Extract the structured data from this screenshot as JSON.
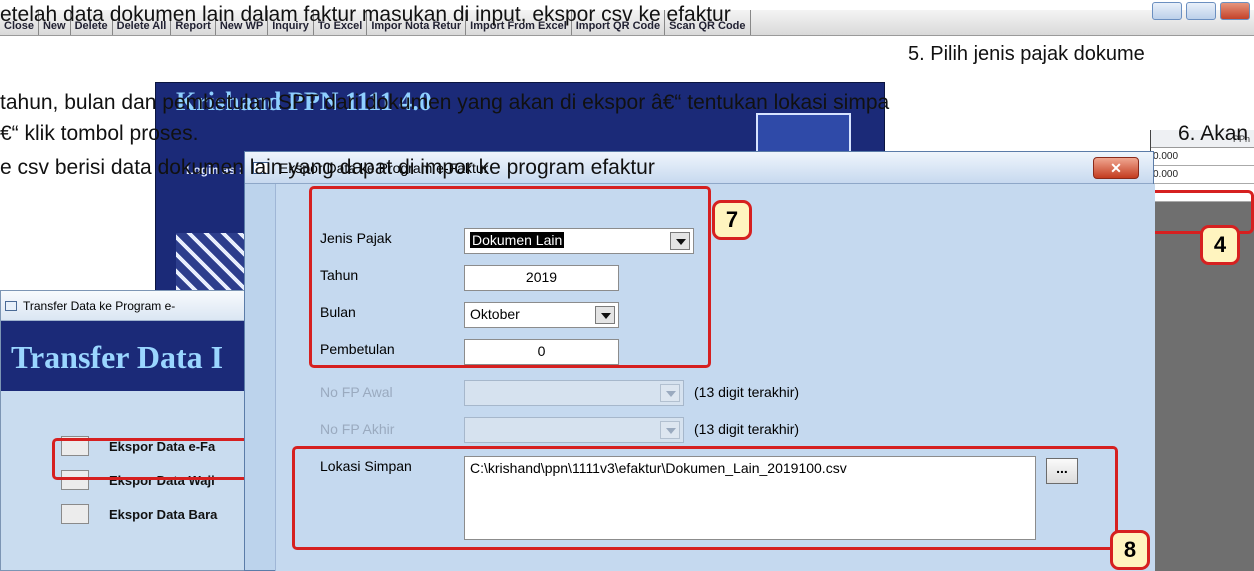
{
  "background_app": {
    "toolbar": [
      "Close",
      "New",
      "Delete",
      "Delete All",
      "Report",
      "New WP",
      "Inquiry",
      "To Excel",
      "Impor Nota Retur",
      "Import From Excel",
      "Import QR Code",
      "Scan QR Code"
    ],
    "logo": "Krishand PPN 1111 4.0",
    "login_label": "Login as :",
    "grid_header": "PPn",
    "grid_values": [
      "0.000",
      "0.000"
    ]
  },
  "transfer_window": {
    "title": "Transfer Data ke Program e-",
    "banner": "Transfer Data I",
    "items": [
      "Ekspor Data e-Fa",
      "Ekspor Data Waji",
      "Ekspor Data Bara"
    ]
  },
  "dialog": {
    "title": "Ekspor Data ke Program e-Faktur",
    "close_symbol": "✕",
    "jenis_pajak": {
      "label": "Jenis Pajak",
      "value": "Dokumen Lain"
    },
    "tahun": {
      "label": "Tahun",
      "value": "2019"
    },
    "bulan": {
      "label": "Bulan",
      "value": "Oktober"
    },
    "pembetulan": {
      "label": "Pembetulan",
      "value": "0"
    },
    "no_fp_awal": {
      "label": "No FP Awal",
      "hint": "(13 digit terakhir)"
    },
    "no_fp_akhir": {
      "label": "No FP Akhir",
      "hint": "(13 digit terakhir)"
    },
    "lokasi_simpan": {
      "label": "Lokasi Simpan",
      "value": "C:\\krishand\\ppn\\1111v3\\efaktur\\Dokumen_Lain_2019100.csv",
      "browse_label": "..."
    }
  },
  "badges": {
    "b4": "4",
    "b7": "7",
    "b8": "8"
  },
  "instructions": {
    "line1": "etelah data dokumen lain dalam faktur masukan di input, ekspor csv ke efaktur",
    "line1b": "5. Pilih jenis pajak dokume",
    "line2": " tahun, bulan dan pembetulan SPT dari dokumen yang akan di ekspor â€“ tentukan lokasi simpa",
    "line3a": "€“ klik tombol proses.",
    "line3b": "6. Akan",
    "line4": "e csv berisi data dokumen lain yang dapat di impor ke program efaktur"
  }
}
